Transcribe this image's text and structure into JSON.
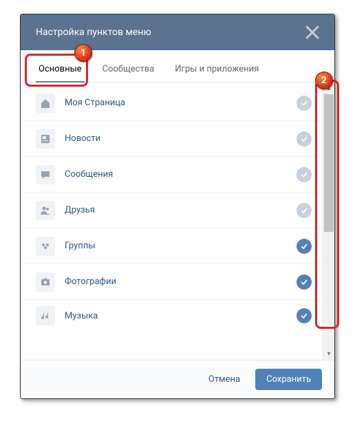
{
  "header": {
    "title": "Настройка пунктов меню"
  },
  "tabs": {
    "main": "Основные",
    "communities": "Сообщества",
    "games": "Игры и приложения"
  },
  "items": [
    {
      "label": "Моя Страница",
      "icon": "home",
      "checked": "off"
    },
    {
      "label": "Новости",
      "icon": "news",
      "checked": "off"
    },
    {
      "label": "Сообщения",
      "icon": "message",
      "checked": "off"
    },
    {
      "label": "Друзья",
      "icon": "friends",
      "checked": "off"
    },
    {
      "label": "Группы",
      "icon": "groups",
      "checked": "on"
    },
    {
      "label": "Фотографии",
      "icon": "photo",
      "checked": "on"
    },
    {
      "label": "Музыка",
      "icon": "music",
      "checked": "on"
    }
  ],
  "footer": {
    "cancel": "Отмена",
    "save": "Сохранить"
  },
  "annotations": {
    "1": "1",
    "2": "2"
  }
}
